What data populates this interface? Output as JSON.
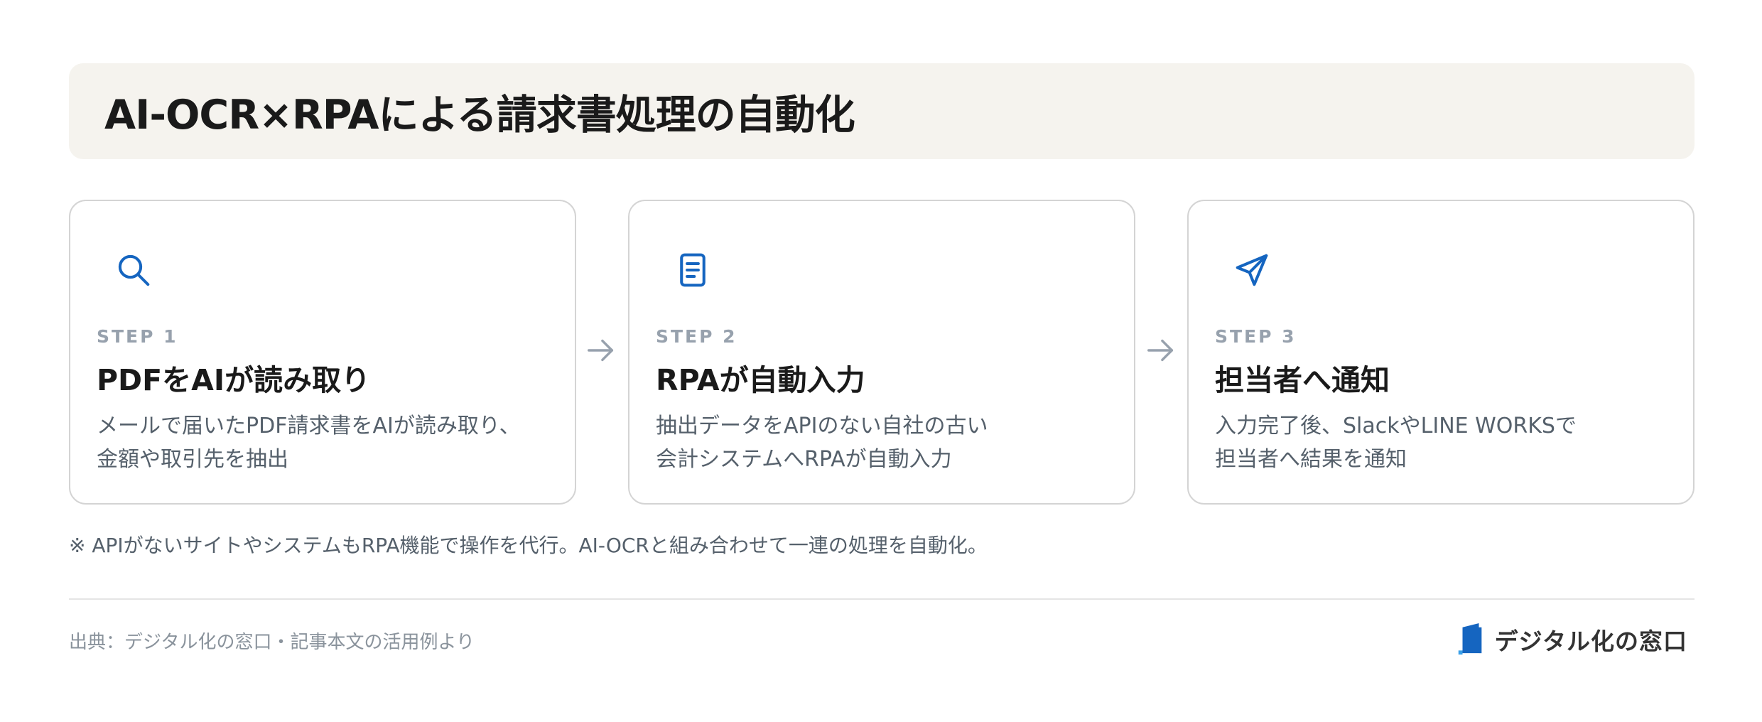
{
  "title": "AI-OCR×RPAによる請求書処理の自動化",
  "colors": {
    "accent": "#1565c0",
    "title_bg": "#f5f3ee",
    "step_label": "#97a1ad",
    "text_muted": "#55606b",
    "arrow": "#97a1ad",
    "border": "#d4d4d4"
  },
  "steps": [
    {
      "icon": "search-icon",
      "label": "STEP 1",
      "heading": "PDFをAIが読み取り",
      "desc_line1": "メールで届いたPDF請求書をAIが読み取り、",
      "desc_line2": "金額や取引先を抽出"
    },
    {
      "icon": "document-icon",
      "label": "STEP 2",
      "heading": "RPAが自動入力",
      "desc_line1": "抽出データをAPIのない自社の古い",
      "desc_line2": "会計システムへRPAが自動入力"
    },
    {
      "icon": "send-icon",
      "label": "STEP 3",
      "heading": "担当者へ通知",
      "desc_line1": "入力完了後、SlackやLINE WORKSで",
      "desc_line2": "担当者へ結果を通知"
    }
  ],
  "note": "※ APIがないサイトやシステムもRPA機能で操作を代行。AI-OCRと組み合わせて一連の処理を自動化。",
  "source": "出典：デジタル化の窓口・記事本文の活用例より",
  "brand": {
    "name": "デジタル化の窓口",
    "logo_icon": "brand-logo-icon"
  }
}
